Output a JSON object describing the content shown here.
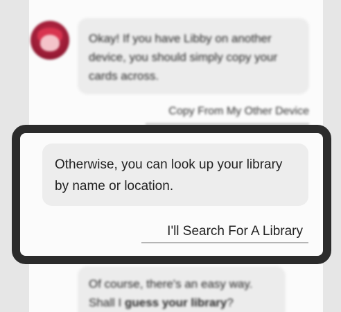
{
  "chat": {
    "top_message": "Okay! If you have Libby on another device, you should simply copy your cards across.",
    "top_reply": "Copy From My Other Device",
    "highlight_message": "Otherwise, you can look up your library by name or location.",
    "highlight_action": "I'll Search For A Library",
    "bottom_message_prefix": "Of course, there's an easy way. Shall I ",
    "bottom_message_bold": "guess your library",
    "bottom_message_suffix": "?"
  },
  "colors": {
    "frame": "#2b2b2b",
    "bubble": "#ececec",
    "avatar": "#b3223f"
  },
  "icons": {
    "avatar": "libby-avatar-icon"
  }
}
